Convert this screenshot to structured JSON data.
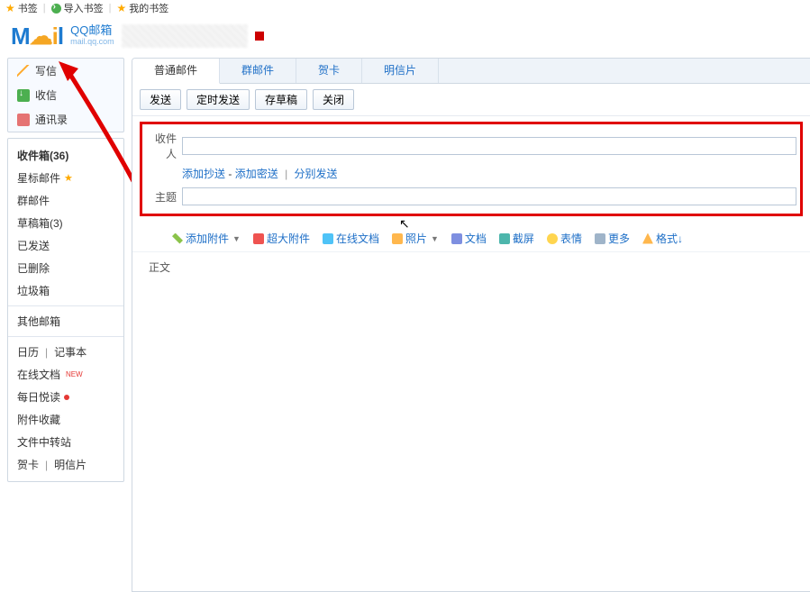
{
  "bookmarks": {
    "b1": "书签",
    "b2": "导入书签",
    "b3": "我的书签"
  },
  "brand": {
    "name_cn": "QQ邮箱"
  },
  "sidebar": {
    "nav": {
      "compose": "写信",
      "receive": "收信",
      "contacts": "通讯录"
    },
    "folders": {
      "inbox": "收件箱(36)",
      "star": "星标邮件",
      "group": "群邮件",
      "draft": "草稿箱(3)",
      "sent": "已发送",
      "trash": "已删除",
      "spam": "垃圾箱",
      "other": "其他邮箱",
      "calendar": "日历",
      "notes": "记事本",
      "onlinedoc": "在线文档",
      "daily": "每日悦读",
      "attfav": "附件收藏",
      "transfer": "文件中转站",
      "greet": "贺卡",
      "postcard": "明信片"
    }
  },
  "tabs": {
    "normal": "普通邮件",
    "group": "群邮件",
    "card": "贺卡",
    "post": "明信片"
  },
  "actions": {
    "send": "发送",
    "timed": "定时发送",
    "draft": "存草稿",
    "close": "关闭"
  },
  "form": {
    "to_label": "收件人",
    "cc": "添加抄送",
    "bcc": "添加密送",
    "sep1": "-",
    "sep2": "|",
    "split": "分别发送",
    "subject_label": "主题",
    "body_label": "正文"
  },
  "attach": {
    "add": "添加附件",
    "big": "超大附件",
    "cloud": "在线文档",
    "photo": "照片",
    "doc": "文档",
    "shot": "截屏",
    "emoji": "表情",
    "more": "更多",
    "format": "格式↓"
  }
}
